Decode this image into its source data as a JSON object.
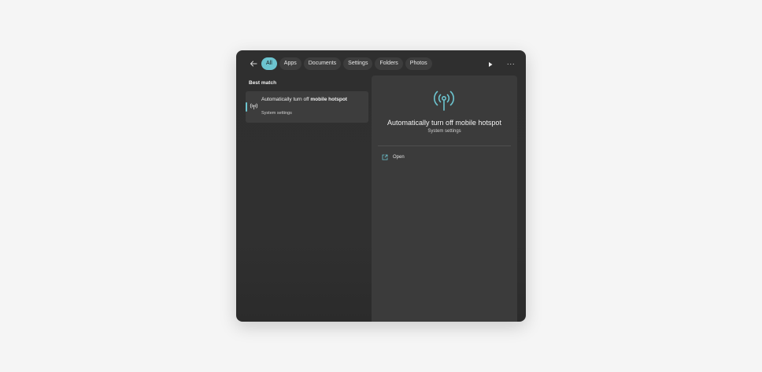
{
  "search": {
    "filters": [
      {
        "label": "All",
        "active": true
      },
      {
        "label": "Apps",
        "active": false
      },
      {
        "label": "Documents",
        "active": false
      },
      {
        "label": "Settings",
        "active": false
      },
      {
        "label": "Folders",
        "active": false
      },
      {
        "label": "Photos",
        "active": false
      }
    ],
    "more_label": "···"
  },
  "results": {
    "section_label": "Best match",
    "best_match": {
      "title_prefix": "Automatically turn off ",
      "title_highlight": "mobile hotspot",
      "subtitle": "System settings",
      "icon": "hotspot-icon"
    }
  },
  "preview": {
    "title": "Automatically turn off mobile hotspot",
    "subtitle": "System settings",
    "icon": "hotspot-icon",
    "actions": [
      {
        "label": "Open",
        "icon": "open-external-icon"
      }
    ]
  },
  "colors": {
    "accent": "#6cc4cf",
    "panel": "#2f2f2f",
    "preview": "#3b3b3b",
    "chip": "#3d3d3d"
  }
}
